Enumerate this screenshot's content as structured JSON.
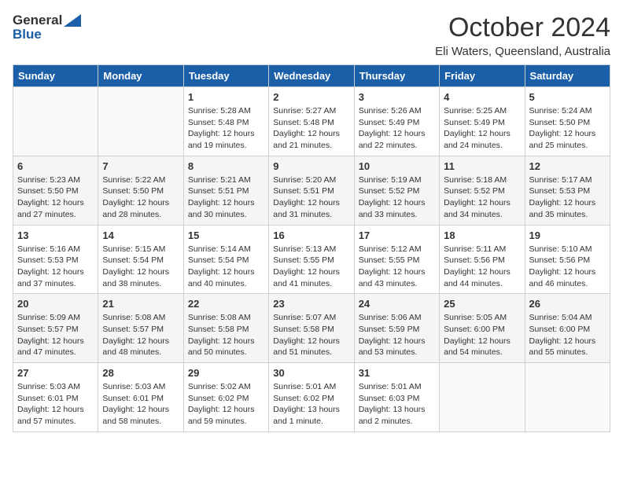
{
  "logo": {
    "general": "General",
    "blue": "Blue"
  },
  "title": "October 2024",
  "subtitle": "Eli Waters, Queensland, Australia",
  "days_of_week": [
    "Sunday",
    "Monday",
    "Tuesday",
    "Wednesday",
    "Thursday",
    "Friday",
    "Saturday"
  ],
  "weeks": [
    [
      {
        "day": "",
        "info": ""
      },
      {
        "day": "",
        "info": ""
      },
      {
        "day": "1",
        "sunrise": "Sunrise: 5:28 AM",
        "sunset": "Sunset: 5:48 PM",
        "daylight": "Daylight: 12 hours and 19 minutes."
      },
      {
        "day": "2",
        "sunrise": "Sunrise: 5:27 AM",
        "sunset": "Sunset: 5:48 PM",
        "daylight": "Daylight: 12 hours and 21 minutes."
      },
      {
        "day": "3",
        "sunrise": "Sunrise: 5:26 AM",
        "sunset": "Sunset: 5:49 PM",
        "daylight": "Daylight: 12 hours and 22 minutes."
      },
      {
        "day": "4",
        "sunrise": "Sunrise: 5:25 AM",
        "sunset": "Sunset: 5:49 PM",
        "daylight": "Daylight: 12 hours and 24 minutes."
      },
      {
        "day": "5",
        "sunrise": "Sunrise: 5:24 AM",
        "sunset": "Sunset: 5:50 PM",
        "daylight": "Daylight: 12 hours and 25 minutes."
      }
    ],
    [
      {
        "day": "6",
        "sunrise": "Sunrise: 5:23 AM",
        "sunset": "Sunset: 5:50 PM",
        "daylight": "Daylight: 12 hours and 27 minutes."
      },
      {
        "day": "7",
        "sunrise": "Sunrise: 5:22 AM",
        "sunset": "Sunset: 5:50 PM",
        "daylight": "Daylight: 12 hours and 28 minutes."
      },
      {
        "day": "8",
        "sunrise": "Sunrise: 5:21 AM",
        "sunset": "Sunset: 5:51 PM",
        "daylight": "Daylight: 12 hours and 30 minutes."
      },
      {
        "day": "9",
        "sunrise": "Sunrise: 5:20 AM",
        "sunset": "Sunset: 5:51 PM",
        "daylight": "Daylight: 12 hours and 31 minutes."
      },
      {
        "day": "10",
        "sunrise": "Sunrise: 5:19 AM",
        "sunset": "Sunset: 5:52 PM",
        "daylight": "Daylight: 12 hours and 33 minutes."
      },
      {
        "day": "11",
        "sunrise": "Sunrise: 5:18 AM",
        "sunset": "Sunset: 5:52 PM",
        "daylight": "Daylight: 12 hours and 34 minutes."
      },
      {
        "day": "12",
        "sunrise": "Sunrise: 5:17 AM",
        "sunset": "Sunset: 5:53 PM",
        "daylight": "Daylight: 12 hours and 35 minutes."
      }
    ],
    [
      {
        "day": "13",
        "sunrise": "Sunrise: 5:16 AM",
        "sunset": "Sunset: 5:53 PM",
        "daylight": "Daylight: 12 hours and 37 minutes."
      },
      {
        "day": "14",
        "sunrise": "Sunrise: 5:15 AM",
        "sunset": "Sunset: 5:54 PM",
        "daylight": "Daylight: 12 hours and 38 minutes."
      },
      {
        "day": "15",
        "sunrise": "Sunrise: 5:14 AM",
        "sunset": "Sunset: 5:54 PM",
        "daylight": "Daylight: 12 hours and 40 minutes."
      },
      {
        "day": "16",
        "sunrise": "Sunrise: 5:13 AM",
        "sunset": "Sunset: 5:55 PM",
        "daylight": "Daylight: 12 hours and 41 minutes."
      },
      {
        "day": "17",
        "sunrise": "Sunrise: 5:12 AM",
        "sunset": "Sunset: 5:55 PM",
        "daylight": "Daylight: 12 hours and 43 minutes."
      },
      {
        "day": "18",
        "sunrise": "Sunrise: 5:11 AM",
        "sunset": "Sunset: 5:56 PM",
        "daylight": "Daylight: 12 hours and 44 minutes."
      },
      {
        "day": "19",
        "sunrise": "Sunrise: 5:10 AM",
        "sunset": "Sunset: 5:56 PM",
        "daylight": "Daylight: 12 hours and 46 minutes."
      }
    ],
    [
      {
        "day": "20",
        "sunrise": "Sunrise: 5:09 AM",
        "sunset": "Sunset: 5:57 PM",
        "daylight": "Daylight: 12 hours and 47 minutes."
      },
      {
        "day": "21",
        "sunrise": "Sunrise: 5:08 AM",
        "sunset": "Sunset: 5:57 PM",
        "daylight": "Daylight: 12 hours and 48 minutes."
      },
      {
        "day": "22",
        "sunrise": "Sunrise: 5:08 AM",
        "sunset": "Sunset: 5:58 PM",
        "daylight": "Daylight: 12 hours and 50 minutes."
      },
      {
        "day": "23",
        "sunrise": "Sunrise: 5:07 AM",
        "sunset": "Sunset: 5:58 PM",
        "daylight": "Daylight: 12 hours and 51 minutes."
      },
      {
        "day": "24",
        "sunrise": "Sunrise: 5:06 AM",
        "sunset": "Sunset: 5:59 PM",
        "daylight": "Daylight: 12 hours and 53 minutes."
      },
      {
        "day": "25",
        "sunrise": "Sunrise: 5:05 AM",
        "sunset": "Sunset: 6:00 PM",
        "daylight": "Daylight: 12 hours and 54 minutes."
      },
      {
        "day": "26",
        "sunrise": "Sunrise: 5:04 AM",
        "sunset": "Sunset: 6:00 PM",
        "daylight": "Daylight: 12 hours and 55 minutes."
      }
    ],
    [
      {
        "day": "27",
        "sunrise": "Sunrise: 5:03 AM",
        "sunset": "Sunset: 6:01 PM",
        "daylight": "Daylight: 12 hours and 57 minutes."
      },
      {
        "day": "28",
        "sunrise": "Sunrise: 5:03 AM",
        "sunset": "Sunset: 6:01 PM",
        "daylight": "Daylight: 12 hours and 58 minutes."
      },
      {
        "day": "29",
        "sunrise": "Sunrise: 5:02 AM",
        "sunset": "Sunset: 6:02 PM",
        "daylight": "Daylight: 12 hours and 59 minutes."
      },
      {
        "day": "30",
        "sunrise": "Sunrise: 5:01 AM",
        "sunset": "Sunset: 6:02 PM",
        "daylight": "Daylight: 13 hours and 1 minute."
      },
      {
        "day": "31",
        "sunrise": "Sunrise: 5:01 AM",
        "sunset": "Sunset: 6:03 PM",
        "daylight": "Daylight: 13 hours and 2 minutes."
      },
      {
        "day": "",
        "info": ""
      },
      {
        "day": "",
        "info": ""
      }
    ]
  ]
}
